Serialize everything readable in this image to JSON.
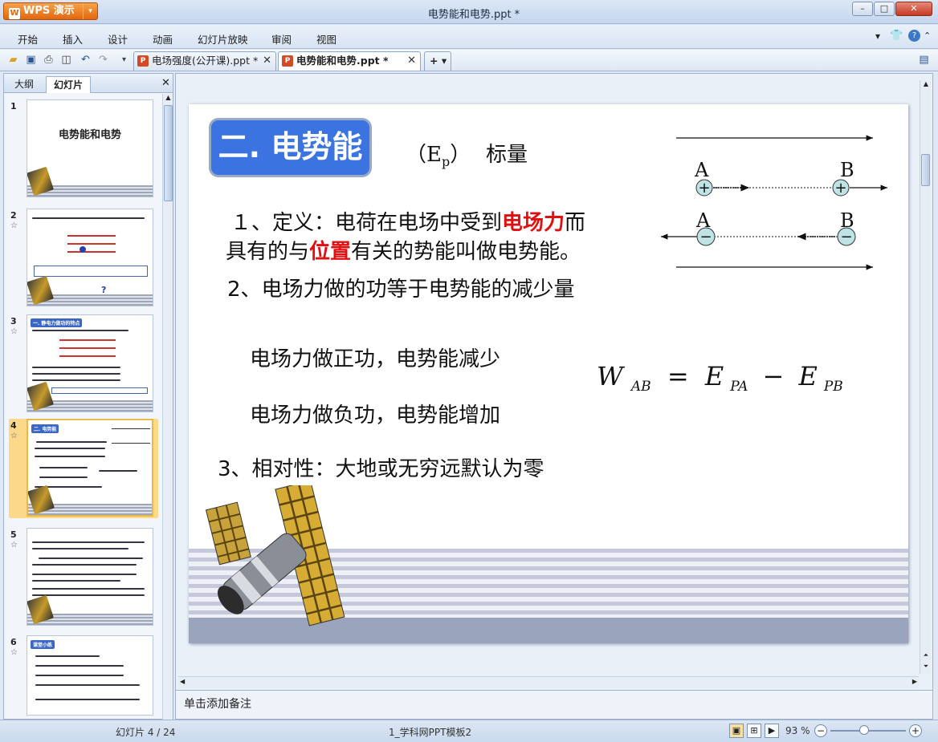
{
  "app": {
    "menu_button": "WPS 演示",
    "doc_title": "电势能和电势.ppt *"
  },
  "menu": [
    "开始",
    "插入",
    "设计",
    "动画",
    "幻灯片放映",
    "审阅",
    "视图"
  ],
  "tabs": [
    {
      "label": "电场强度(公开课).ppt *"
    },
    {
      "label": "电势能和电势.ppt *"
    }
  ],
  "left_panel": {
    "tabs": [
      "大纲",
      "幻灯片"
    ],
    "slides": [
      {
        "num": "1",
        "title": "电势能和电势",
        "starred": false
      },
      {
        "num": "2",
        "title": "",
        "starred": true
      },
      {
        "num": "3",
        "title": "",
        "starred": true
      },
      {
        "num": "4",
        "title": "",
        "starred": true,
        "selected": true
      },
      {
        "num": "5",
        "title": "",
        "starred": true
      },
      {
        "num": "6",
        "title": "",
        "starred": true
      }
    ],
    "thumb_texts": {
      "s2_q": "?",
      "s3_title": "一. 静电力做功的特点",
      "s4_title": "二. 电势能",
      "s6_title": "课堂小练"
    }
  },
  "slide": {
    "title_box": "二. 电势能",
    "ep_open": "（E",
    "ep_sub": "p",
    "ep_close": "）",
    "scalar": "标量",
    "def_line1_a": "１、定义：电荷在电场中受到",
    "def_line1_red": "电场力",
    "def_line1_b": "而",
    "def_line2_a": "具有的与",
    "def_line2_red": "位置",
    "def_line2_b": "有关的势能叫做电势能。",
    "line2": "2、电场力做的功等于电势能的减少量",
    "pos_work": "电场力做正功，电势能减少",
    "neg_work": "电场力做负功，电势能增加",
    "line3": "3、相对性：大地或无穷远默认为零",
    "formula": {
      "W": "W",
      "Wsub": "AB",
      "eq": "=",
      "E1": "E",
      "E1sub": "PA",
      "minus": "−",
      "E2": "E",
      "E2sub": "PB"
    },
    "diagram": {
      "A": "A",
      "B": "B",
      "A2": "A",
      "B2": "B",
      "plus": "+",
      "minus": "−"
    }
  },
  "notes": "单击添加备注",
  "status": {
    "slide_pos": "幻灯片 4 / 24",
    "template": "1_学科网PPT模板2",
    "zoom": "93 %"
  }
}
